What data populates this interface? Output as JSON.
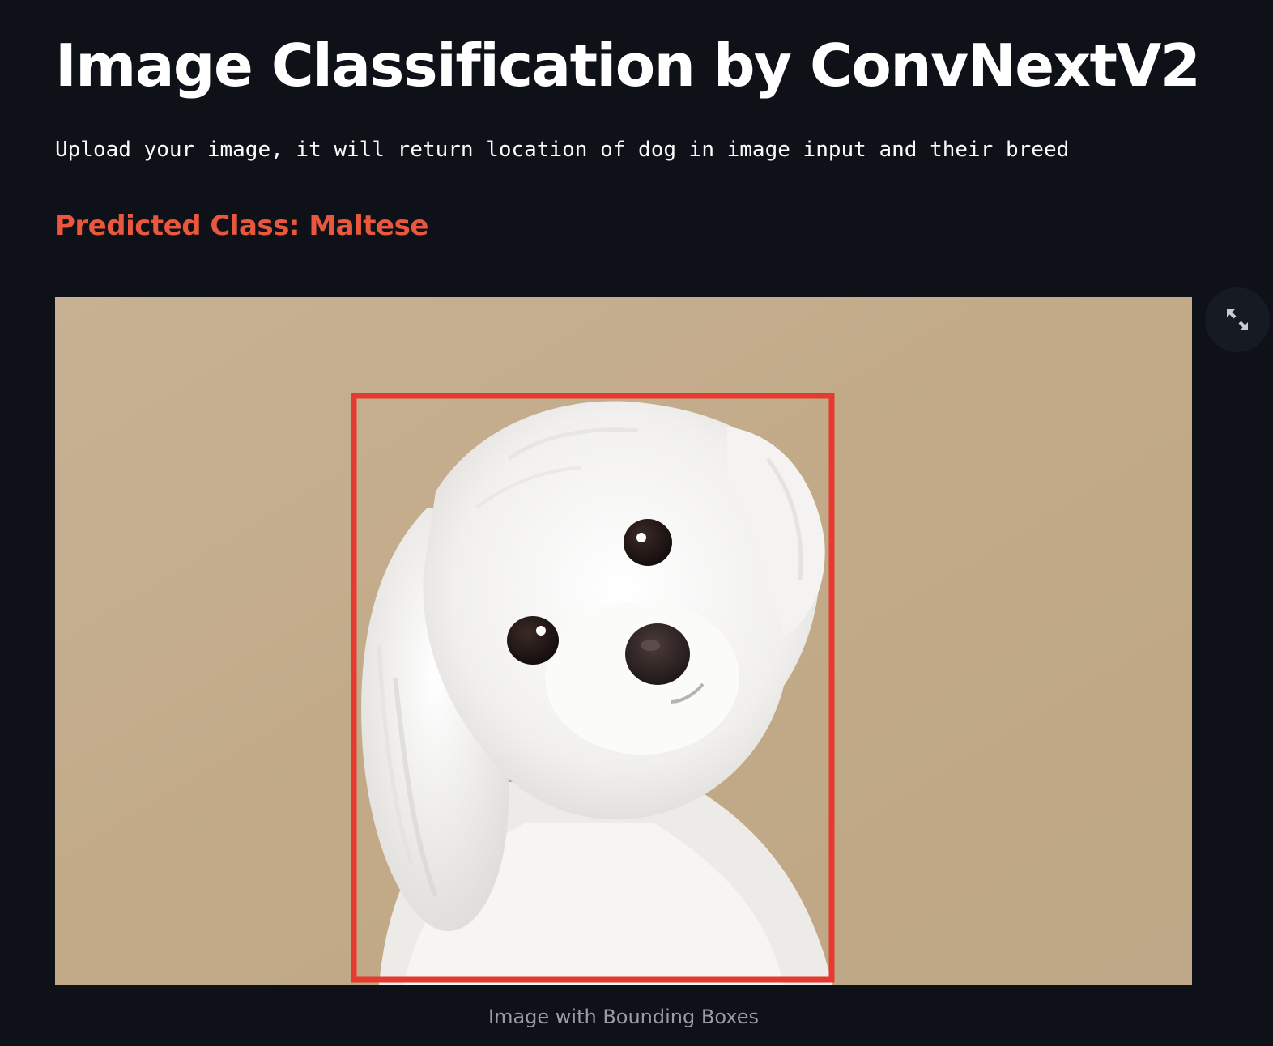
{
  "header": {
    "title": "Image Classification by ConvNextV2",
    "subtitle": "Upload your image, it will return location of dog in image input and their breed"
  },
  "result": {
    "predicted_label": "Predicted Class: Maltese",
    "image_caption": "Image with Bounding Boxes",
    "bbox_color": "#e53a2f"
  },
  "controls": {
    "fullscreen_icon": "expand-arrows-icon"
  },
  "colors": {
    "background": "#0e1117",
    "accent": "#e9573f",
    "image_background": "#c4ad8d"
  }
}
